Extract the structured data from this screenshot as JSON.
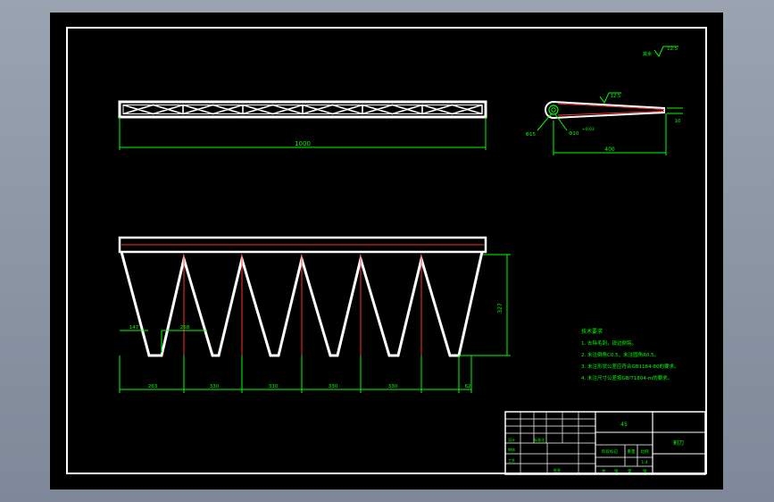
{
  "top_view": {
    "length_dim": "1000"
  },
  "side_view": {
    "surface_mark_top": "12.5",
    "surface_mark_left": "其余",
    "surface_mark_mid": "12.5",
    "length_dim": "400",
    "thickness_dim": "10",
    "hole_dim": "Φ15",
    "hole_fit": "Φ10",
    "hole_tol": "+0.03"
  },
  "front_view": {
    "height_dim": "327",
    "tooth_top_dim": "147",
    "tooth_bottom_dim": "258",
    "pitch_dims": [
      "263",
      "330",
      "330",
      "330",
      "330"
    ],
    "end_dim": "62"
  },
  "tech_notes": {
    "title": "技术要求",
    "items": [
      "1. 去除毛刺，锐边倒钝。",
      "2. 未注倒角C0.5，未注圆角R0.5。",
      "3. 未注形状公差应符合GB1184-80的要求。",
      "4. 未注尺寸公差按GB/T1804-m的要求。"
    ]
  },
  "title_block": {
    "material": "45",
    "part_name": "割刀",
    "stage_label": "阶段标记",
    "weight_label": "重量",
    "scale_label": "比例",
    "scale_value": "1:4",
    "sheet_label": "共",
    "sheet_of_label": "张",
    "sheet_no_label": "第",
    "designer_label": "设计",
    "standard_label": "标准化",
    "reviewer_label": "审核",
    "process_label": "工艺",
    "approve_label": "批准"
  }
}
